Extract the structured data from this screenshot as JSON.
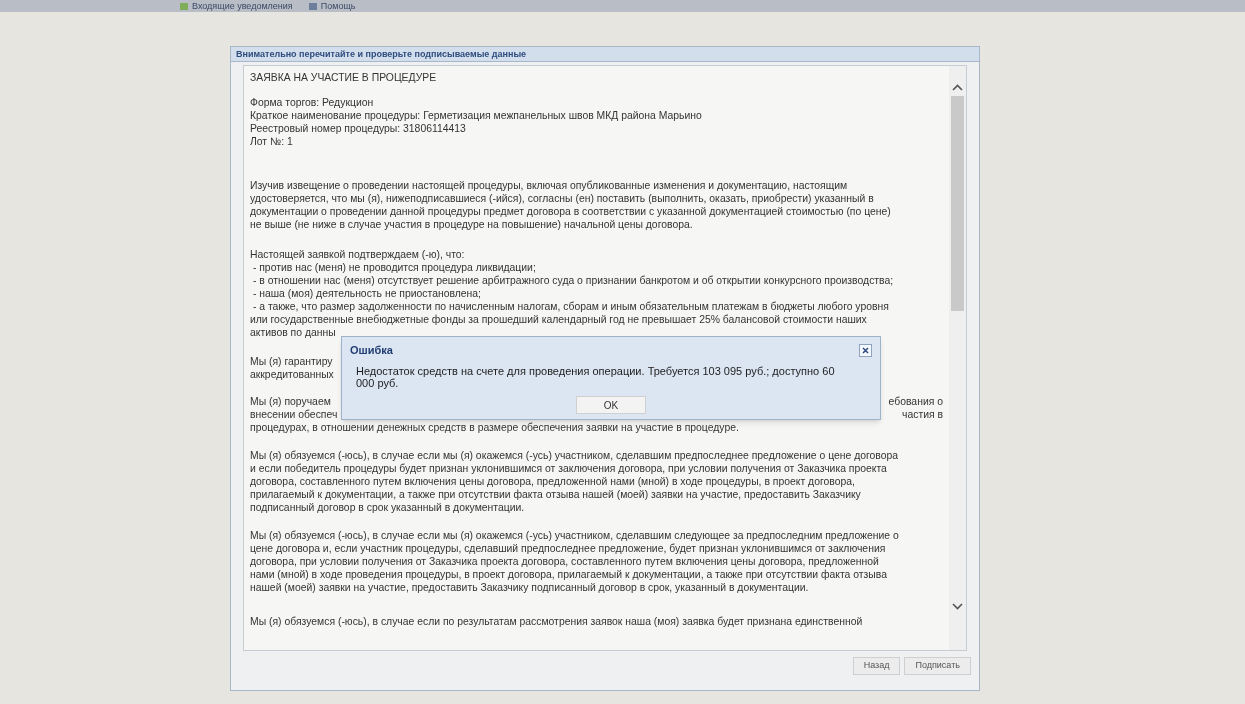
{
  "menu_bar": {
    "items": [
      {
        "label": "Входящие уведомления"
      },
      {
        "label": "Помощь"
      }
    ]
  },
  "panel": {
    "title": "Внимательно перечитайте и проверьте подписываемые данные"
  },
  "document": {
    "title": "ЗАЯВКА НА УЧАСТИЕ В ПРОЦЕДУРЕ",
    "paragraphs": [
      {
        "lines": [
          {
            "text": "Форма торгов: Редукцион"
          },
          {
            "text": "Краткое наименование процедуры: Герметизация межпанельных швов МКД района Марьино"
          },
          {
            "text": "Реестровый номер процедуры: 31806114413"
          },
          {
            "text": "Лот №: 1"
          }
        ]
      },
      {
        "lines": [
          {
            "text": "Изучив извещение о проведении настоящей процедуры, включая опубликованные изменения и документацию, настоящим"
          },
          {
            "text": "удостоверяется, что мы (я), нижеподписавшиеся (-ийся), согласны (ен) поставить (выполнить, оказать, приобрести) указанный в"
          },
          {
            "text": "документации о проведении данной процедуры предмет договора в соответствии с указанной документацией стоимостью (по цене)"
          },
          {
            "text": "не выше (не ниже в случае участия в процедуре на повышение) начальной цены договора."
          }
        ]
      },
      {
        "lines": [
          {
            "text": "Настоящей заявкой подтверждаем (-ю), что:"
          },
          {
            "text": " - против нас (меня) не проводится процедура ликвидации;"
          },
          {
            "text": " - в отношении нас (меня) отсутствует решение арбитражного суда о признании банкротом и об открытии конкурсного производства;"
          },
          {
            "text": " - наша (моя) деятельность не приостановлена;"
          },
          {
            "text": " - а также, что размер задолженности по начисленным налогам, сборам и иным обязательным платежам в бюджеты любого уровня"
          },
          {
            "text": "или государственные внебюджетные фонды за прошедший календарный год не превышает 25% балансовой стоимости наших"
          },
          {
            "left": "активов по данны"
          }
        ]
      },
      {
        "lines": [
          {
            "left": "Мы (я) гарантиру"
          },
          {
            "left": "аккредитованных"
          }
        ]
      },
      {
        "lines": [
          {
            "left": "Мы (я) поручаем",
            "right": "ебования о"
          },
          {
            "left": "внесении обеспеч",
            "right": "частия в"
          },
          {
            "text": "процедурах, в отношении денежных средств в размере обеспечения заявки на участие в процедуре."
          }
        ]
      },
      {
        "lines": [
          {
            "text": "Мы (я) обязуемся (-юсь), в случае если мы (я) окажемся (-усь) участником, сделавшим предпоследнее предложение о цене договора"
          },
          {
            "text": "и если победитель процедуры будет признан уклонившимся от заключения договора, при условии получения от Заказчика проекта"
          },
          {
            "text": "договора, составленного путем включения цены договора, предложенной нами (мной) в ходе процедуры, в проект договора,"
          },
          {
            "text": "прилагаемый к документации, а также при отсутствии факта отзыва нашей (моей) заявки на участие, предоставить Заказчику"
          },
          {
            "text": "подписанный договор в срок указанный в документации."
          }
        ]
      },
      {
        "lines": [
          {
            "text": "Мы (я) обязуемся (-юсь), в случае если мы (я) окажемся (-усь) участником, сделавшим следующее за предпоследним предложение о"
          },
          {
            "text": "цене договора и, если участник процедуры, сделавший предпоследнее предложение, будет признан уклонившимся от заключения"
          },
          {
            "text": "договора, при условии получения от Заказчика проекта договора, составленного путем включения цены договора, предложенной"
          },
          {
            "text": "нами (мной) в ходе проведения процедуры, в проект договора, прилагаемый к документации, а также при отсутствии факта отзыва"
          },
          {
            "text": "нашей (моей) заявки на участие, предоставить Заказчику подписанный договор в срок, указанный в документации."
          }
        ]
      },
      {
        "lines": [
          {
            "text": "Мы (я) обязуемся (-юсь), в случае если по результатам рассмотрения заявок наша (моя) заявка будет признана единственной"
          }
        ]
      }
    ]
  },
  "buttons": [
    {
      "label": "Назад"
    },
    {
      "label": "Подписать"
    }
  ],
  "dialog": {
    "title": "Ошибка",
    "message": "Недостаток средств на счете для проведения операции. Требуется 103 095 руб.; доступно 60 000 руб.",
    "button": "OK"
  }
}
